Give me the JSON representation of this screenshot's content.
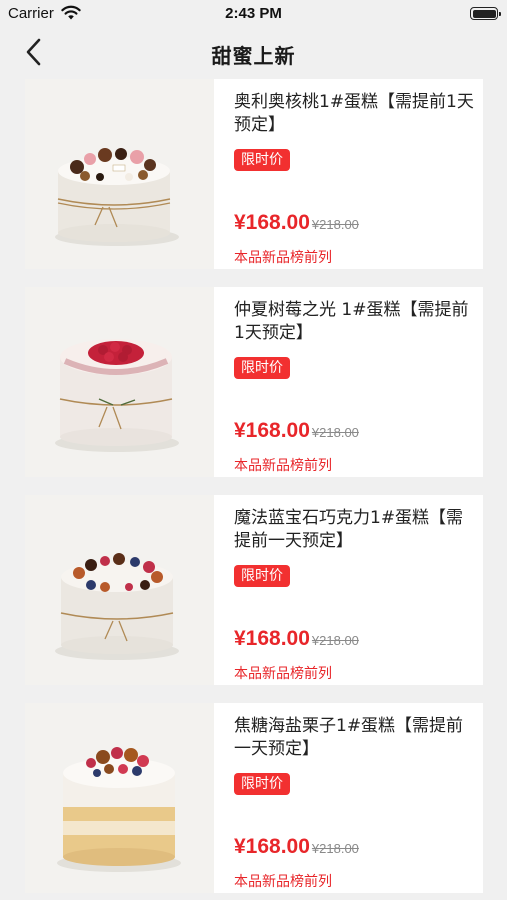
{
  "status_bar": {
    "carrier": "Carrier",
    "time": "2:43 PM"
  },
  "nav": {
    "title": "甜蜜上新"
  },
  "colors": {
    "accent": "#e8262a",
    "badge": "#f23030"
  },
  "products": [
    {
      "title": "奥利奥核桃1#蛋糕【需提前1天预定】",
      "badge": "限时价",
      "price": "¥168.00",
      "original_price": "¥218.00",
      "rank_note": "本品新品榜前列",
      "image_icon": "cake-oreo-walnut"
    },
    {
      "title": "仲夏树莓之光 1#蛋糕【需提前1天预定】",
      "badge": "限时价",
      "price": "¥168.00",
      "original_price": "¥218.00",
      "rank_note": "本品新品榜前列",
      "image_icon": "cake-raspberry"
    },
    {
      "title": "魔法蓝宝石巧克力1#蛋糕【需提前一天预定】",
      "badge": "限时价",
      "price": "¥168.00",
      "original_price": "¥218.00",
      "rank_note": "本品新品榜前列",
      "image_icon": "cake-blueberry-chocolate"
    },
    {
      "title": "焦糖海盐栗子1#蛋糕【需提前一天预定】",
      "badge": "限时价",
      "price": "¥168.00",
      "original_price": "¥218.00",
      "rank_note": "本品新品榜前列",
      "image_icon": "cake-caramel-chestnut"
    }
  ]
}
